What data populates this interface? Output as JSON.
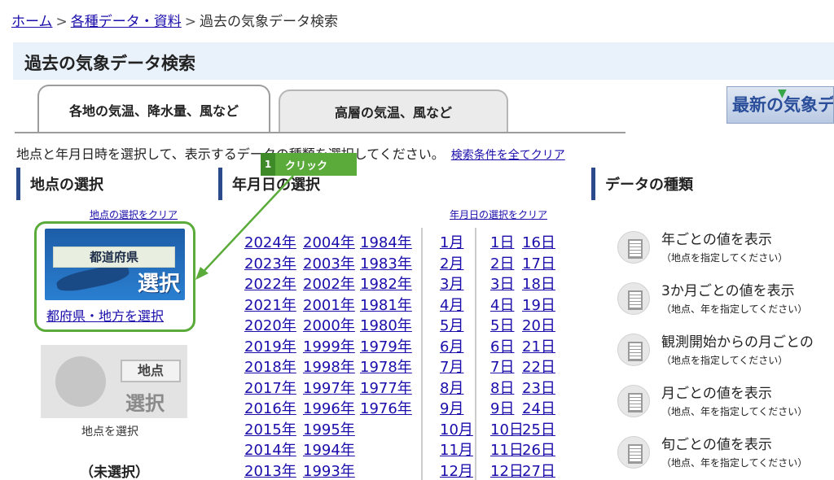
{
  "breadcrumb": {
    "home": "ホーム",
    "data": "各種データ・資料",
    "current": "過去の気象データ検索",
    "sep": ">"
  },
  "page_title": "過去の気象データ検索",
  "tabs": [
    {
      "label": "各地の気温、降水量、風など"
    },
    {
      "label": "高層の気温、風など"
    }
  ],
  "banner": {
    "text": "最新の気象デ"
  },
  "instruction": {
    "text": "地点と年月日時を選択して、表示するデータの種類を選択してください。",
    "clear_all": "検索条件を全てクリア"
  },
  "sections": {
    "location": "地点の選択",
    "date": "年月日の選択",
    "data_type": "データの種類"
  },
  "location": {
    "clear": "地点の選択をクリア",
    "pref_label": "都道府県",
    "pref_select_word": "選択",
    "pref_link": "都府県・地方を選択",
    "point_label": "地点",
    "point_select_word": "選択",
    "point_caption": "地点を選択",
    "status": "（未選択）"
  },
  "date": {
    "clear": "年月日の選択をクリア",
    "years_col1": [
      "2024年",
      "2023年",
      "2022年",
      "2021年",
      "2020年",
      "2019年",
      "2018年",
      "2017年",
      "2016年",
      "2015年",
      "2014年",
      "2013年"
    ],
    "years_col2": [
      "2004年",
      "2003年",
      "2002年",
      "2001年",
      "2000年",
      "1999年",
      "1998年",
      "1997年",
      "1996年",
      "1995年",
      "1994年",
      "1993年"
    ],
    "years_col3": [
      "1984年",
      "1983年",
      "1982年",
      "1981年",
      "1980年",
      "1979年",
      "1978年",
      "1977年",
      "1976年"
    ],
    "months": [
      "1月",
      "2月",
      "3月",
      "4月",
      "5月",
      "6月",
      "7月",
      "8月",
      "9月",
      "10月",
      "11月",
      "12月"
    ],
    "days_col1": [
      "1日",
      "2日",
      "3日",
      "4日",
      "5日",
      "6日",
      "7日",
      "8日",
      "9日",
      "10日",
      "11日",
      "12日"
    ],
    "days_col2": [
      "16日",
      "17日",
      "18日",
      "19日",
      "20日",
      "21日",
      "22日",
      "23日",
      "24日",
      "25日",
      "26日",
      "27日"
    ]
  },
  "data_types": [
    {
      "title": "年ごとの値を表示",
      "sub": "（地点を指定してください）"
    },
    {
      "title": "3か月ごとの値を表示",
      "sub": "（地点、年を指定してください）"
    },
    {
      "title": "観測開始からの月ごとの",
      "sub": "（地点を指定してください）"
    },
    {
      "title": "月ごとの値を表示",
      "sub": "（地点、年を指定してください）"
    },
    {
      "title": "旬ごとの値を表示",
      "sub": "（地点、年を指定してください）"
    }
  ],
  "annotation": {
    "number": "1",
    "label": "クリック",
    "color": "#5aab3a"
  }
}
